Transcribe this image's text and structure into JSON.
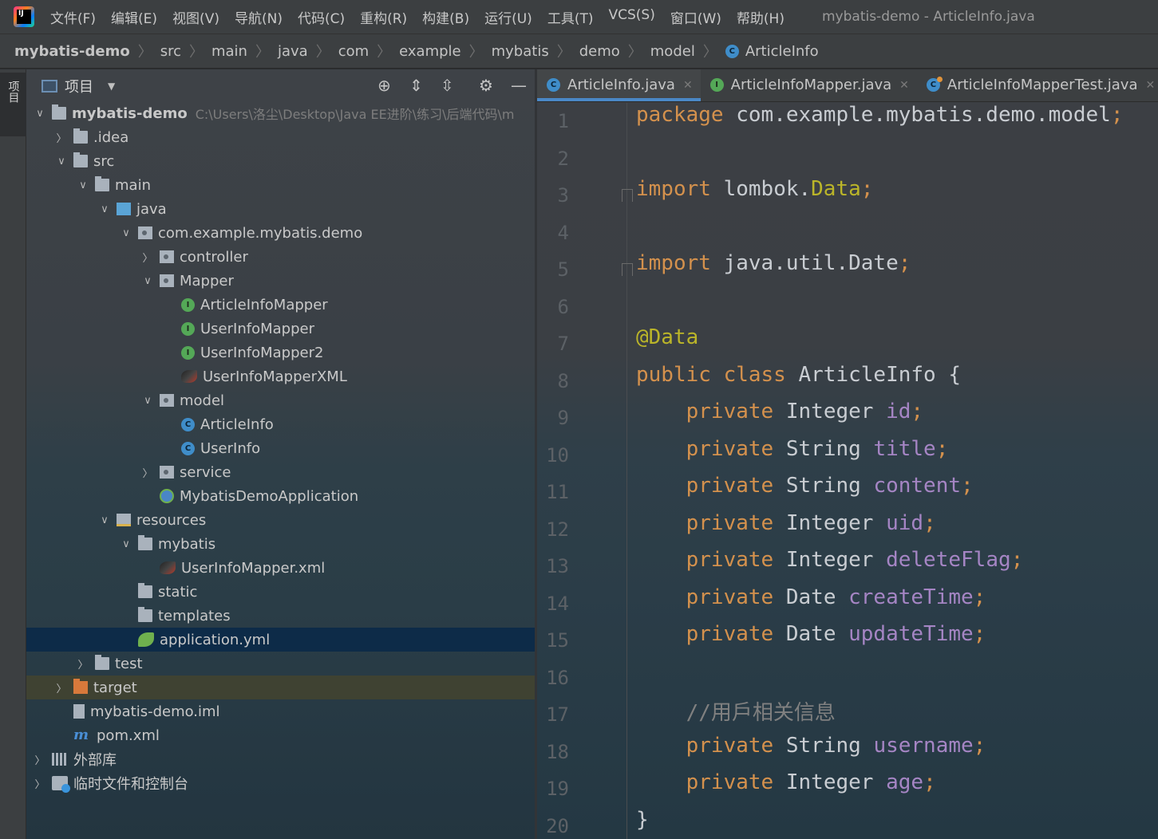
{
  "menubar": {
    "logo_text": "IJ",
    "items": [
      "文件(F)",
      "编辑(E)",
      "视图(V)",
      "导航(N)",
      "代码(C)",
      "重构(R)",
      "构建(B)",
      "运行(U)",
      "工具(T)",
      "VCS(S)",
      "窗口(W)",
      "帮助(H)"
    ],
    "window_title": "mybatis-demo - ArticleInfo.java"
  },
  "breadcrumb": [
    "mybatis-demo",
    "src",
    "main",
    "java",
    "com",
    "example",
    "mybatis",
    "demo",
    "model",
    "ArticleInfo"
  ],
  "sidestrip": {
    "label": "项目"
  },
  "project_panel": {
    "title": "项目",
    "tree": [
      {
        "label": "mybatis-demo",
        "arrow": "down",
        "icon": "module-folder-icon",
        "path": "C:\\Users\\洛尘\\Desktop\\Java EE进阶\\练习\\后端代码\\m"
      },
      {
        "label": ".idea",
        "arrow": "right",
        "icon": "folder-icon"
      },
      {
        "label": "src",
        "arrow": "down",
        "icon": "folder-icon"
      },
      {
        "label": "main",
        "arrow": "down",
        "icon": "folder-icon"
      },
      {
        "label": "java",
        "arrow": "down",
        "icon": "source-folder-icon"
      },
      {
        "label": "com.example.mybatis.demo",
        "arrow": "down",
        "icon": "package-icon"
      },
      {
        "label": "controller",
        "arrow": "right",
        "icon": "package-icon"
      },
      {
        "label": "Mapper",
        "arrow": "down",
        "icon": "package-icon"
      },
      {
        "label": "ArticleInfoMapper",
        "arrow": "",
        "icon": "interface-icon"
      },
      {
        "label": "UserInfoMapper",
        "arrow": "",
        "icon": "interface-icon"
      },
      {
        "label": "UserInfoMapper2",
        "arrow": "",
        "icon": "interface-icon"
      },
      {
        "label": "UserInfoMapperXML",
        "arrow": "",
        "icon": "mybatis-bird-icon"
      },
      {
        "label": "model",
        "arrow": "down",
        "icon": "package-icon"
      },
      {
        "label": "ArticleInfo",
        "arrow": "",
        "icon": "class-icon"
      },
      {
        "label": "UserInfo",
        "arrow": "",
        "icon": "class-icon"
      },
      {
        "label": "service",
        "arrow": "right",
        "icon": "package-icon"
      },
      {
        "label": "MybatisDemoApplication",
        "arrow": "",
        "icon": "spring-boot-icon"
      },
      {
        "label": "resources",
        "arrow": "down",
        "icon": "resources-folder-icon"
      },
      {
        "label": "mybatis",
        "arrow": "down",
        "icon": "folder-icon"
      },
      {
        "label": "UserInfoMapper.xml",
        "arrow": "",
        "icon": "mybatis-bird-icon"
      },
      {
        "label": "static",
        "arrow": "",
        "icon": "folder-icon"
      },
      {
        "label": "templates",
        "arrow": "",
        "icon": "folder-icon"
      },
      {
        "label": "application.yml",
        "arrow": "",
        "icon": "spring-yml-icon",
        "selected": true
      },
      {
        "label": "test",
        "arrow": "right",
        "icon": "folder-icon"
      },
      {
        "label": "target",
        "arrow": "right",
        "icon": "excluded-folder-icon",
        "highlighted": true
      },
      {
        "label": "mybatis-demo.iml",
        "arrow": "",
        "icon": "iml-file-icon"
      },
      {
        "label": "pom.xml",
        "arrow": "",
        "icon": "maven-icon"
      },
      {
        "label": "外部库",
        "arrow": "right",
        "icon": "library-icon"
      },
      {
        "label": "临时文件和控制台",
        "arrow": "right",
        "icon": "scratch-icon"
      }
    ]
  },
  "editor": {
    "tabs": [
      {
        "label": "ArticleInfo.java",
        "icon": "class-icon",
        "active": true
      },
      {
        "label": "ArticleInfoMapper.java",
        "icon": "interface-icon",
        "active": false
      },
      {
        "label": "ArticleInfoMapperTest.java",
        "icon": "test-class-icon",
        "active": false
      }
    ],
    "line_numbers": [
      "1",
      "2",
      "3",
      "4",
      "5",
      "6",
      "7",
      "8",
      "9",
      "10",
      "11",
      "12",
      "13",
      "14",
      "15",
      "16",
      "17",
      "18",
      "19",
      "20"
    ],
    "code_lines": [
      [
        [
          "kw",
          "package"
        ],
        [
          "tp",
          " com.example.mybatis.demo.model"
        ],
        [
          "kw",
          ";"
        ]
      ],
      [],
      [
        [
          "kw",
          "import"
        ],
        [
          "tp",
          " lombok."
        ],
        [
          "an",
          "Data"
        ],
        [
          "kw",
          ";"
        ]
      ],
      [],
      [
        [
          "kw",
          "import"
        ],
        [
          "tp",
          " java.util.Date"
        ],
        [
          "kw",
          ";"
        ]
      ],
      [],
      [
        [
          "an",
          "@Data"
        ]
      ],
      [
        [
          "kw",
          "public class"
        ],
        [
          "tp",
          " ArticleInfo {"
        ]
      ],
      [
        [
          "tp",
          "    "
        ],
        [
          "kw",
          "private"
        ],
        [
          "tp",
          " Integer "
        ],
        [
          "fd",
          "id"
        ],
        [
          "kw",
          ";"
        ]
      ],
      [
        [
          "tp",
          "    "
        ],
        [
          "kw",
          "private"
        ],
        [
          "tp",
          " String "
        ],
        [
          "fd",
          "title"
        ],
        [
          "kw",
          ";"
        ]
      ],
      [
        [
          "tp",
          "    "
        ],
        [
          "kw",
          "private"
        ],
        [
          "tp",
          " String "
        ],
        [
          "fd",
          "content"
        ],
        [
          "kw",
          ";"
        ]
      ],
      [
        [
          "tp",
          "    "
        ],
        [
          "kw",
          "private"
        ],
        [
          "tp",
          " Integer "
        ],
        [
          "fd",
          "uid"
        ],
        [
          "kw",
          ";"
        ]
      ],
      [
        [
          "tp",
          "    "
        ],
        [
          "kw",
          "private"
        ],
        [
          "tp",
          " Integer "
        ],
        [
          "fd",
          "deleteFlag"
        ],
        [
          "kw",
          ";"
        ]
      ],
      [
        [
          "tp",
          "    "
        ],
        [
          "kw",
          "private"
        ],
        [
          "tp",
          " Date "
        ],
        [
          "fd",
          "createTime"
        ],
        [
          "kw",
          ";"
        ]
      ],
      [
        [
          "tp",
          "    "
        ],
        [
          "kw",
          "private"
        ],
        [
          "tp",
          " Date "
        ],
        [
          "fd",
          "updateTime"
        ],
        [
          "kw",
          ";"
        ]
      ],
      [],
      [
        [
          "tp",
          "    "
        ],
        [
          "cm",
          "//用戶相关信息"
        ]
      ],
      [
        [
          "tp",
          "    "
        ],
        [
          "kw",
          "private"
        ],
        [
          "tp",
          " String "
        ],
        [
          "fd",
          "username"
        ],
        [
          "kw",
          ";"
        ]
      ],
      [
        [
          "tp",
          "    "
        ],
        [
          "kw",
          "private"
        ],
        [
          "tp",
          " Integer "
        ],
        [
          "fd",
          "age"
        ],
        [
          "kw",
          ";"
        ]
      ],
      [
        [
          "tp",
          "}"
        ]
      ]
    ]
  },
  "colors": {
    "keyword": "#d4914d",
    "field": "#a585c4",
    "annotation": "#bbb529",
    "comment": "#808080",
    "selection": "#0d2b48",
    "accent": "#4a88c7"
  }
}
